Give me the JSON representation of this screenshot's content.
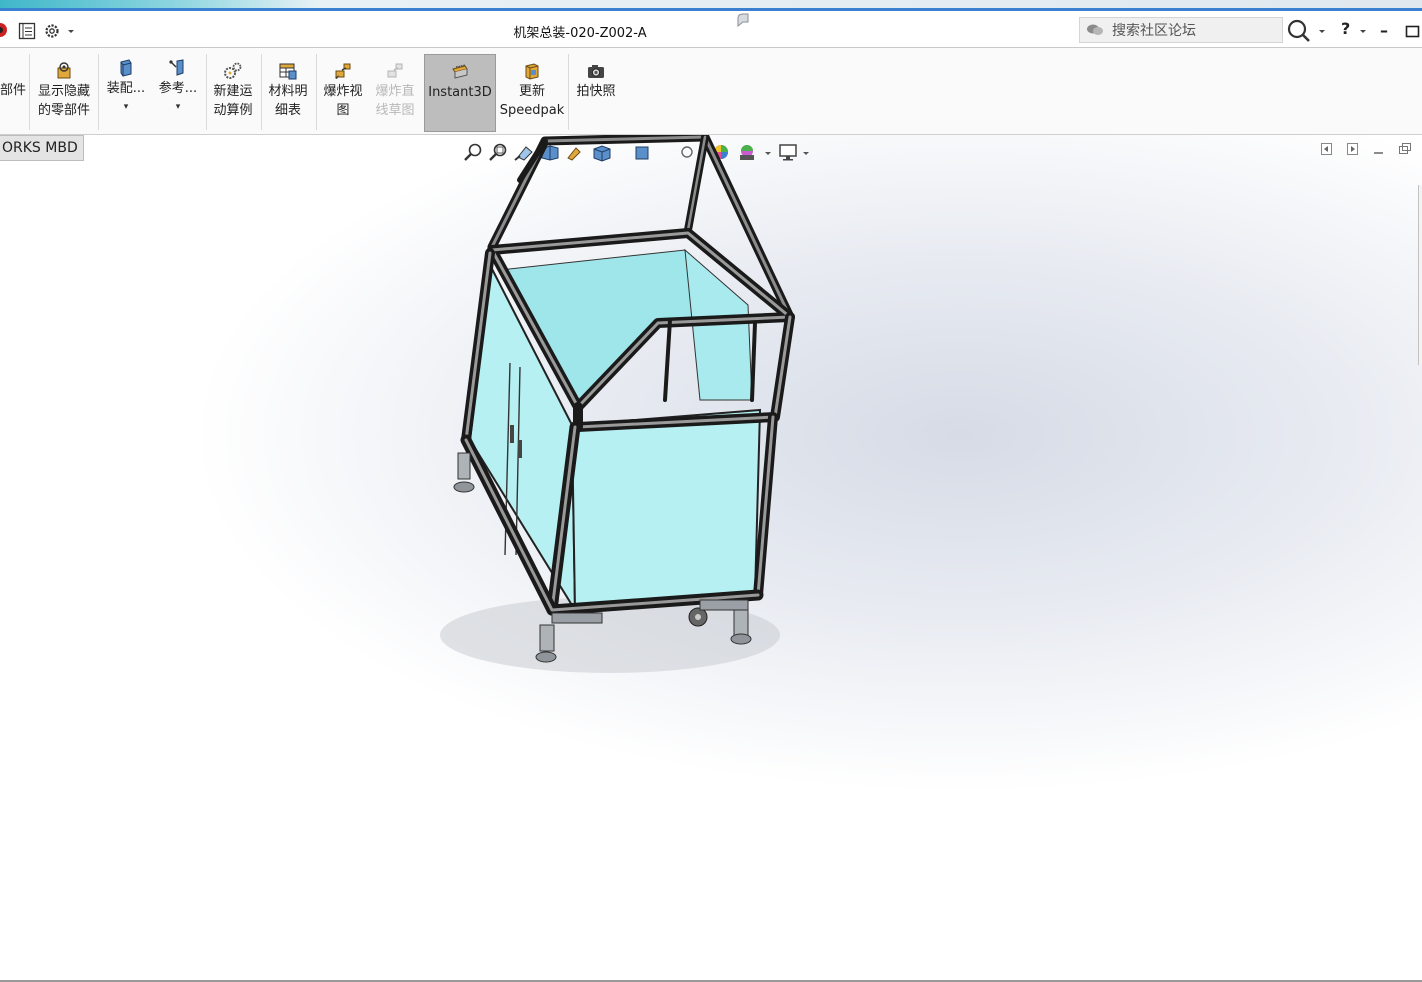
{
  "window": {
    "title": "机架总装-020-Z002-A"
  },
  "search": {
    "placeholder": "搜索社区论坛"
  },
  "title_controls": {
    "help": "?",
    "minimize": "–"
  },
  "ribbon": {
    "items": [
      {
        "id": "parts",
        "label": "部件"
      },
      {
        "id": "show-hidden",
        "label": "显示隐藏\n的零部件"
      },
      {
        "id": "assembly",
        "label": "装配..."
      },
      {
        "id": "reference",
        "label": "参考..."
      },
      {
        "id": "new-motion",
        "label": "新建运\n动算例"
      },
      {
        "id": "bom",
        "label": "材料明\n细表"
      },
      {
        "id": "exploded-view",
        "label": "爆炸视\n图"
      },
      {
        "id": "explode-line",
        "label": "爆炸直\n线草图"
      },
      {
        "id": "instant3d",
        "label": "Instant3D"
      },
      {
        "id": "update-speedpak",
        "label": "更新\nSpeedpak"
      },
      {
        "id": "snapshot",
        "label": "拍快照"
      }
    ]
  },
  "tabs": {
    "mbd": "ORKS MBD"
  },
  "colors": {
    "accent_blue": "#3b7fd1",
    "panel_glass": "#b6f0f2",
    "frame_dark": "#2a2a2a",
    "instant3d_active": "#bdbdbd"
  }
}
